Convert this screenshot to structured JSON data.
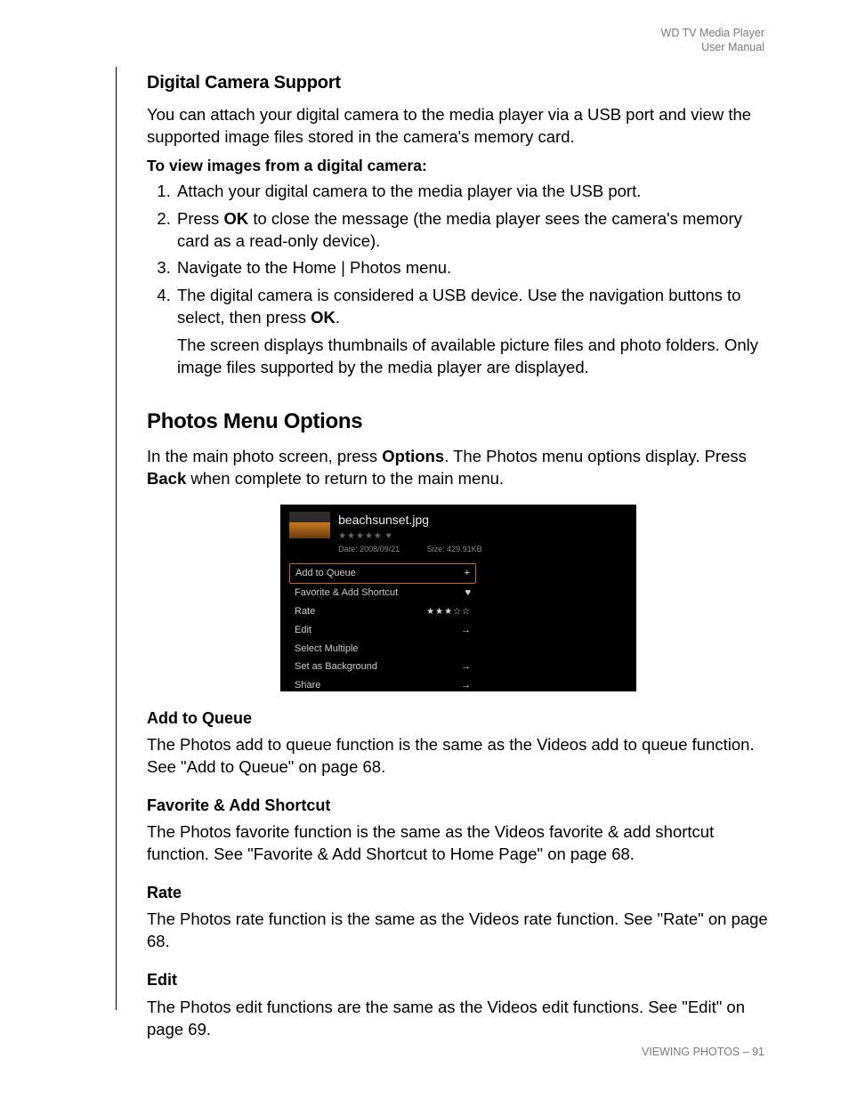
{
  "header": {
    "line1": "WD TV Media Player",
    "line2": "User Manual"
  },
  "sect1": {
    "title": "Digital Camera Support",
    "intro": "You can attach your digital camera to the media player via a USB port and view the supported image files stored in the camera's memory card.",
    "steps_label": "To view images from a digital camera:",
    "s1": "Attach your digital camera to the media player via the USB port.",
    "s2a": "Press ",
    "s2b": "OK",
    "s2c": " to close the message (the media player sees the camera's memory card as a read-only device).",
    "s3": "Navigate to the Home | Photos menu.",
    "s4a": "The digital camera is considered a USB device. Use the navigation buttons to select, then press ",
    "s4b": "OK",
    "s4c": ".",
    "s4follow": "The screen displays thumbnails of available picture files and photo folders. Only image files supported by the media player are displayed."
  },
  "sect2": {
    "title": "Photos Menu Options",
    "intro_a": "In the main photo screen, press ",
    "intro_b": "Options",
    "intro_c": ". The Photos menu options display. Press ",
    "intro_d": "Back",
    "intro_e": " when complete to return to the main menu."
  },
  "shot": {
    "filename": "beachsunset.jpg",
    "stars": "★★★★★  ♥",
    "date": "Date: 2008/09/21",
    "size": "Size: 429.91KB",
    "menu": {
      "add": {
        "label": "Add to Queue",
        "sym": "+"
      },
      "fav": {
        "label": "Favorite & Add Shortcut",
        "sym": "♥"
      },
      "rate": {
        "label": "Rate",
        "sym": "★★★☆☆"
      },
      "edit": {
        "label": "Edit",
        "sym": "→"
      },
      "selm": {
        "label": "Select Multiple",
        "sym": ""
      },
      "bg": {
        "label": "Set as Background",
        "sym": "→"
      },
      "share": {
        "label": "Share",
        "sym": "→"
      }
    }
  },
  "sub": {
    "add": {
      "h": "Add to Queue",
      "p": "The Photos add to queue function is the same as the Videos add to queue function. See \"Add to Queue\" on page 68."
    },
    "fav": {
      "h": "Favorite & Add Shortcut",
      "p": "The Photos favorite function is the same as the Videos favorite & add shortcut function. See \"Favorite & Add Shortcut to Home Page\" on page 68."
    },
    "rate": {
      "h": "Rate",
      "p": "The Photos rate function is the same as the Videos rate function. See \"Rate\" on page 68."
    },
    "edit": {
      "h": "Edit",
      "p": "The Photos edit functions are the same as the Videos edit functions. See \"Edit\" on page 69."
    }
  },
  "footer": {
    "section": "VIEWING PHOTOS",
    "dash": " – ",
    "page": "91"
  }
}
